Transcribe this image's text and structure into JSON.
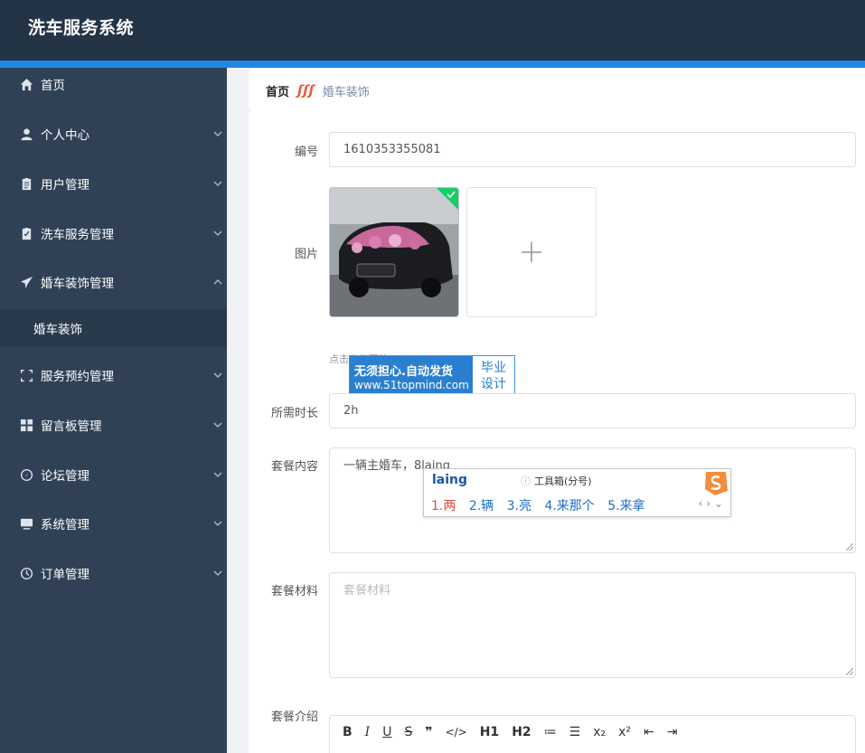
{
  "app": {
    "title": "洗车服务系统"
  },
  "sidebar": {
    "items": [
      {
        "label": "首页",
        "icon": "home-icon",
        "top": 0
      },
      {
        "label": "个人中心",
        "icon": "user-icon",
        "top": 0
      },
      {
        "label": "用户管理",
        "icon": "clipboard-icon",
        "top": 0
      },
      {
        "label": "洗车服务管理",
        "icon": "checklist-icon",
        "top": 0
      },
      {
        "label": "婚车装饰管理",
        "icon": "send-icon",
        "top": 0
      },
      {
        "label": "服务预约管理",
        "icon": "frame-icon",
        "top": 0
      },
      {
        "label": "留言板管理",
        "icon": "grid-icon",
        "top": 0
      },
      {
        "label": "论坛管理",
        "icon": "compass-icon",
        "top": 0
      },
      {
        "label": "系统管理",
        "icon": "monitor-icon",
        "top": 0
      },
      {
        "label": "订单管理",
        "icon": "clock-icon",
        "top": 0
      }
    ],
    "sub_item": "婚车装饰"
  },
  "breadcrumb": {
    "home": "首页",
    "current": "婚车装饰"
  },
  "form": {
    "number_label": "编号",
    "number_value": "1610353355081",
    "image_label": "图片",
    "upload_tip": "点击上传图片",
    "duration_label": "所需时长",
    "duration_value": "2h",
    "content_label": "套餐内容",
    "content_value": "一辆主婚车，8laing",
    "material_label": "套餐材料",
    "material_placeholder": "套餐材料",
    "intro_label": "套餐介绍"
  },
  "watermark": {
    "line1": "无须担心.自动发货",
    "line2": "www.51topmind.com",
    "right1": "毕业",
    "right2": "设计"
  },
  "ime": {
    "pinyin": "laing",
    "toolbox": "工具箱(分号)",
    "candidates": [
      "1.两",
      "2.辆",
      "3.亮",
      "4.来那个",
      "5.来拿"
    ]
  },
  "editor": {
    "buttons": [
      "B",
      "I",
      "U",
      "S",
      "❞",
      "</>",
      "H1",
      "H2",
      "≔",
      "☰",
      "x₂",
      "x²",
      "⇤",
      "⇥"
    ]
  },
  "colors": {
    "header": "#243447",
    "sidebar": "#304156",
    "accent": "#1e88e5"
  }
}
